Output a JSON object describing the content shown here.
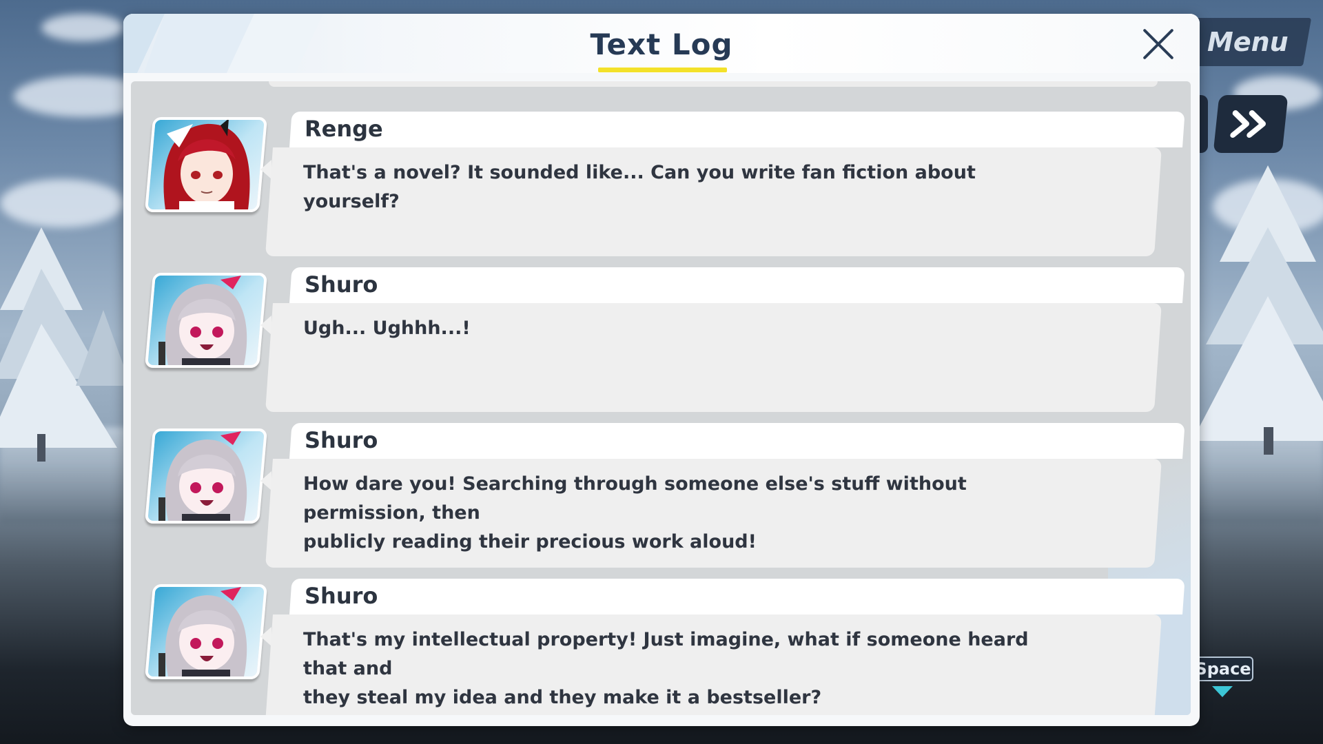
{
  "hud": {
    "menu_label": "Menu",
    "space_label": "Space",
    "skip_icon": "fast-forward-icon",
    "auto_icon": "auto-icon"
  },
  "modal": {
    "title": "Text Log",
    "close_icon": "close-icon",
    "accent_color": "#f3e12a",
    "title_color": "#263a55"
  },
  "entries": [
    {
      "speaker": "Renge",
      "text": "That's a novel? It sounded like... Can you write fan fiction about yourself?",
      "portrait": "renge-portrait"
    },
    {
      "speaker": "Shuro",
      "text": "Ugh... Ughhh...!",
      "portrait": "shuro-portrait"
    },
    {
      "speaker": "Shuro",
      "text": "How dare you! Searching through someone else's stuff without permission, then\npublicly reading their precious work aloud!",
      "portrait": "shuro-portrait"
    },
    {
      "speaker": "Shuro",
      "text": "That's my intellectual property! Just imagine, what if someone heard that and\nthey steal my idea and they make it a bestseller?",
      "portrait": "shuro-portrait"
    }
  ]
}
